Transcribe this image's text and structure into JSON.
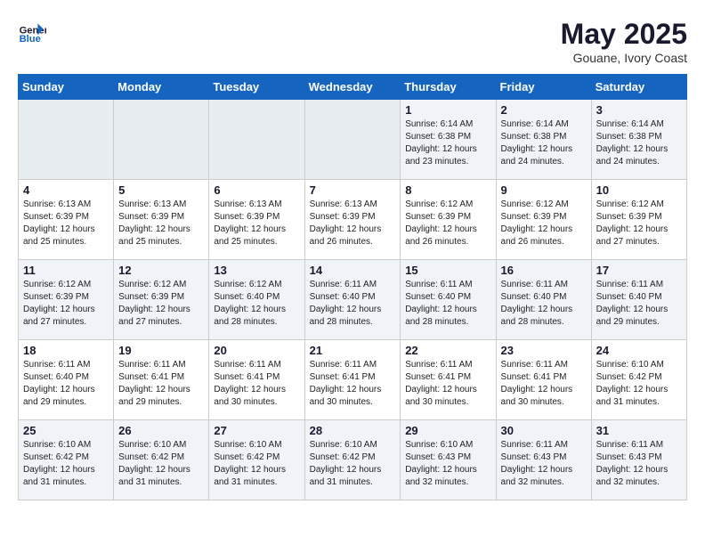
{
  "header": {
    "logo_general": "General",
    "logo_blue": "Blue",
    "month_year": "May 2025",
    "location": "Gouane, Ivory Coast"
  },
  "weekdays": [
    "Sunday",
    "Monday",
    "Tuesday",
    "Wednesday",
    "Thursday",
    "Friday",
    "Saturday"
  ],
  "weeks": [
    [
      {
        "day": "",
        "info": ""
      },
      {
        "day": "",
        "info": ""
      },
      {
        "day": "",
        "info": ""
      },
      {
        "day": "",
        "info": ""
      },
      {
        "day": "1",
        "info": "Sunrise: 6:14 AM\nSunset: 6:38 PM\nDaylight: 12 hours\nand 23 minutes."
      },
      {
        "day": "2",
        "info": "Sunrise: 6:14 AM\nSunset: 6:38 PM\nDaylight: 12 hours\nand 24 minutes."
      },
      {
        "day": "3",
        "info": "Sunrise: 6:14 AM\nSunset: 6:38 PM\nDaylight: 12 hours\nand 24 minutes."
      }
    ],
    [
      {
        "day": "4",
        "info": "Sunrise: 6:13 AM\nSunset: 6:39 PM\nDaylight: 12 hours\nand 25 minutes."
      },
      {
        "day": "5",
        "info": "Sunrise: 6:13 AM\nSunset: 6:39 PM\nDaylight: 12 hours\nand 25 minutes."
      },
      {
        "day": "6",
        "info": "Sunrise: 6:13 AM\nSunset: 6:39 PM\nDaylight: 12 hours\nand 25 minutes."
      },
      {
        "day": "7",
        "info": "Sunrise: 6:13 AM\nSunset: 6:39 PM\nDaylight: 12 hours\nand 26 minutes."
      },
      {
        "day": "8",
        "info": "Sunrise: 6:12 AM\nSunset: 6:39 PM\nDaylight: 12 hours\nand 26 minutes."
      },
      {
        "day": "9",
        "info": "Sunrise: 6:12 AM\nSunset: 6:39 PM\nDaylight: 12 hours\nand 26 minutes."
      },
      {
        "day": "10",
        "info": "Sunrise: 6:12 AM\nSunset: 6:39 PM\nDaylight: 12 hours\nand 27 minutes."
      }
    ],
    [
      {
        "day": "11",
        "info": "Sunrise: 6:12 AM\nSunset: 6:39 PM\nDaylight: 12 hours\nand 27 minutes."
      },
      {
        "day": "12",
        "info": "Sunrise: 6:12 AM\nSunset: 6:39 PM\nDaylight: 12 hours\nand 27 minutes."
      },
      {
        "day": "13",
        "info": "Sunrise: 6:12 AM\nSunset: 6:40 PM\nDaylight: 12 hours\nand 28 minutes."
      },
      {
        "day": "14",
        "info": "Sunrise: 6:11 AM\nSunset: 6:40 PM\nDaylight: 12 hours\nand 28 minutes."
      },
      {
        "day": "15",
        "info": "Sunrise: 6:11 AM\nSunset: 6:40 PM\nDaylight: 12 hours\nand 28 minutes."
      },
      {
        "day": "16",
        "info": "Sunrise: 6:11 AM\nSunset: 6:40 PM\nDaylight: 12 hours\nand 28 minutes."
      },
      {
        "day": "17",
        "info": "Sunrise: 6:11 AM\nSunset: 6:40 PM\nDaylight: 12 hours\nand 29 minutes."
      }
    ],
    [
      {
        "day": "18",
        "info": "Sunrise: 6:11 AM\nSunset: 6:40 PM\nDaylight: 12 hours\nand 29 minutes."
      },
      {
        "day": "19",
        "info": "Sunrise: 6:11 AM\nSunset: 6:41 PM\nDaylight: 12 hours\nand 29 minutes."
      },
      {
        "day": "20",
        "info": "Sunrise: 6:11 AM\nSunset: 6:41 PM\nDaylight: 12 hours\nand 30 minutes."
      },
      {
        "day": "21",
        "info": "Sunrise: 6:11 AM\nSunset: 6:41 PM\nDaylight: 12 hours\nand 30 minutes."
      },
      {
        "day": "22",
        "info": "Sunrise: 6:11 AM\nSunset: 6:41 PM\nDaylight: 12 hours\nand 30 minutes."
      },
      {
        "day": "23",
        "info": "Sunrise: 6:11 AM\nSunset: 6:41 PM\nDaylight: 12 hours\nand 30 minutes."
      },
      {
        "day": "24",
        "info": "Sunrise: 6:10 AM\nSunset: 6:42 PM\nDaylight: 12 hours\nand 31 minutes."
      }
    ],
    [
      {
        "day": "25",
        "info": "Sunrise: 6:10 AM\nSunset: 6:42 PM\nDaylight: 12 hours\nand 31 minutes."
      },
      {
        "day": "26",
        "info": "Sunrise: 6:10 AM\nSunset: 6:42 PM\nDaylight: 12 hours\nand 31 minutes."
      },
      {
        "day": "27",
        "info": "Sunrise: 6:10 AM\nSunset: 6:42 PM\nDaylight: 12 hours\nand 31 minutes."
      },
      {
        "day": "28",
        "info": "Sunrise: 6:10 AM\nSunset: 6:42 PM\nDaylight: 12 hours\nand 31 minutes."
      },
      {
        "day": "29",
        "info": "Sunrise: 6:10 AM\nSunset: 6:43 PM\nDaylight: 12 hours\nand 32 minutes."
      },
      {
        "day": "30",
        "info": "Sunrise: 6:11 AM\nSunset: 6:43 PM\nDaylight: 12 hours\nand 32 minutes."
      },
      {
        "day": "31",
        "info": "Sunrise: 6:11 AM\nSunset: 6:43 PM\nDaylight: 12 hours\nand 32 minutes."
      }
    ]
  ]
}
